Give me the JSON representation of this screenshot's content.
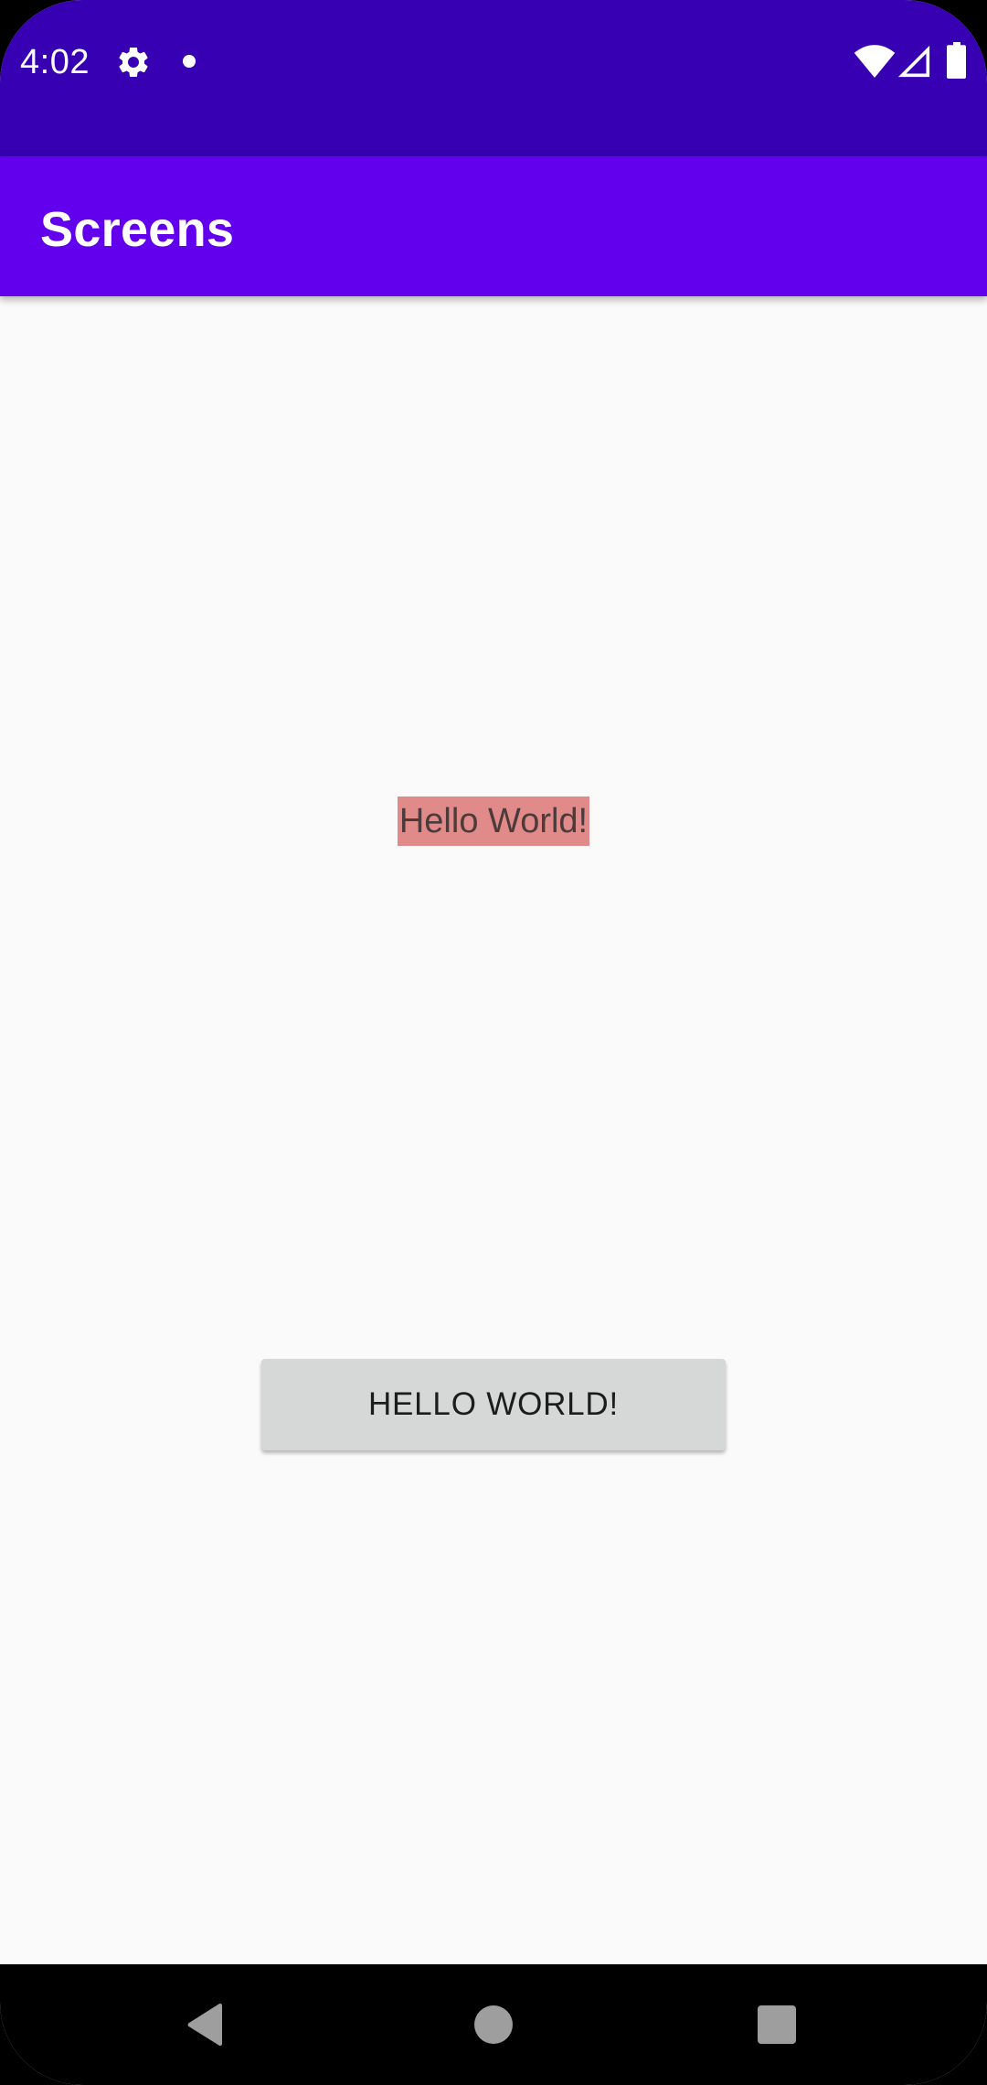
{
  "status_bar": {
    "time": "4:02",
    "background_color": "#3700b3",
    "icons": [
      "gear-icon",
      "notification-dot-icon",
      "wifi-icon",
      "signal-icon",
      "battery-icon"
    ]
  },
  "app_bar": {
    "title": "Screens",
    "background_color": "#6200ee"
  },
  "content": {
    "hello_text": "Hello World!",
    "hello_text_background": "#e08a8a",
    "button_label": "HELLO WORLD!",
    "button_color": "#d6d7d7"
  },
  "nav_bar": {
    "icons": [
      "back-icon",
      "home-icon",
      "recents-icon"
    ]
  }
}
